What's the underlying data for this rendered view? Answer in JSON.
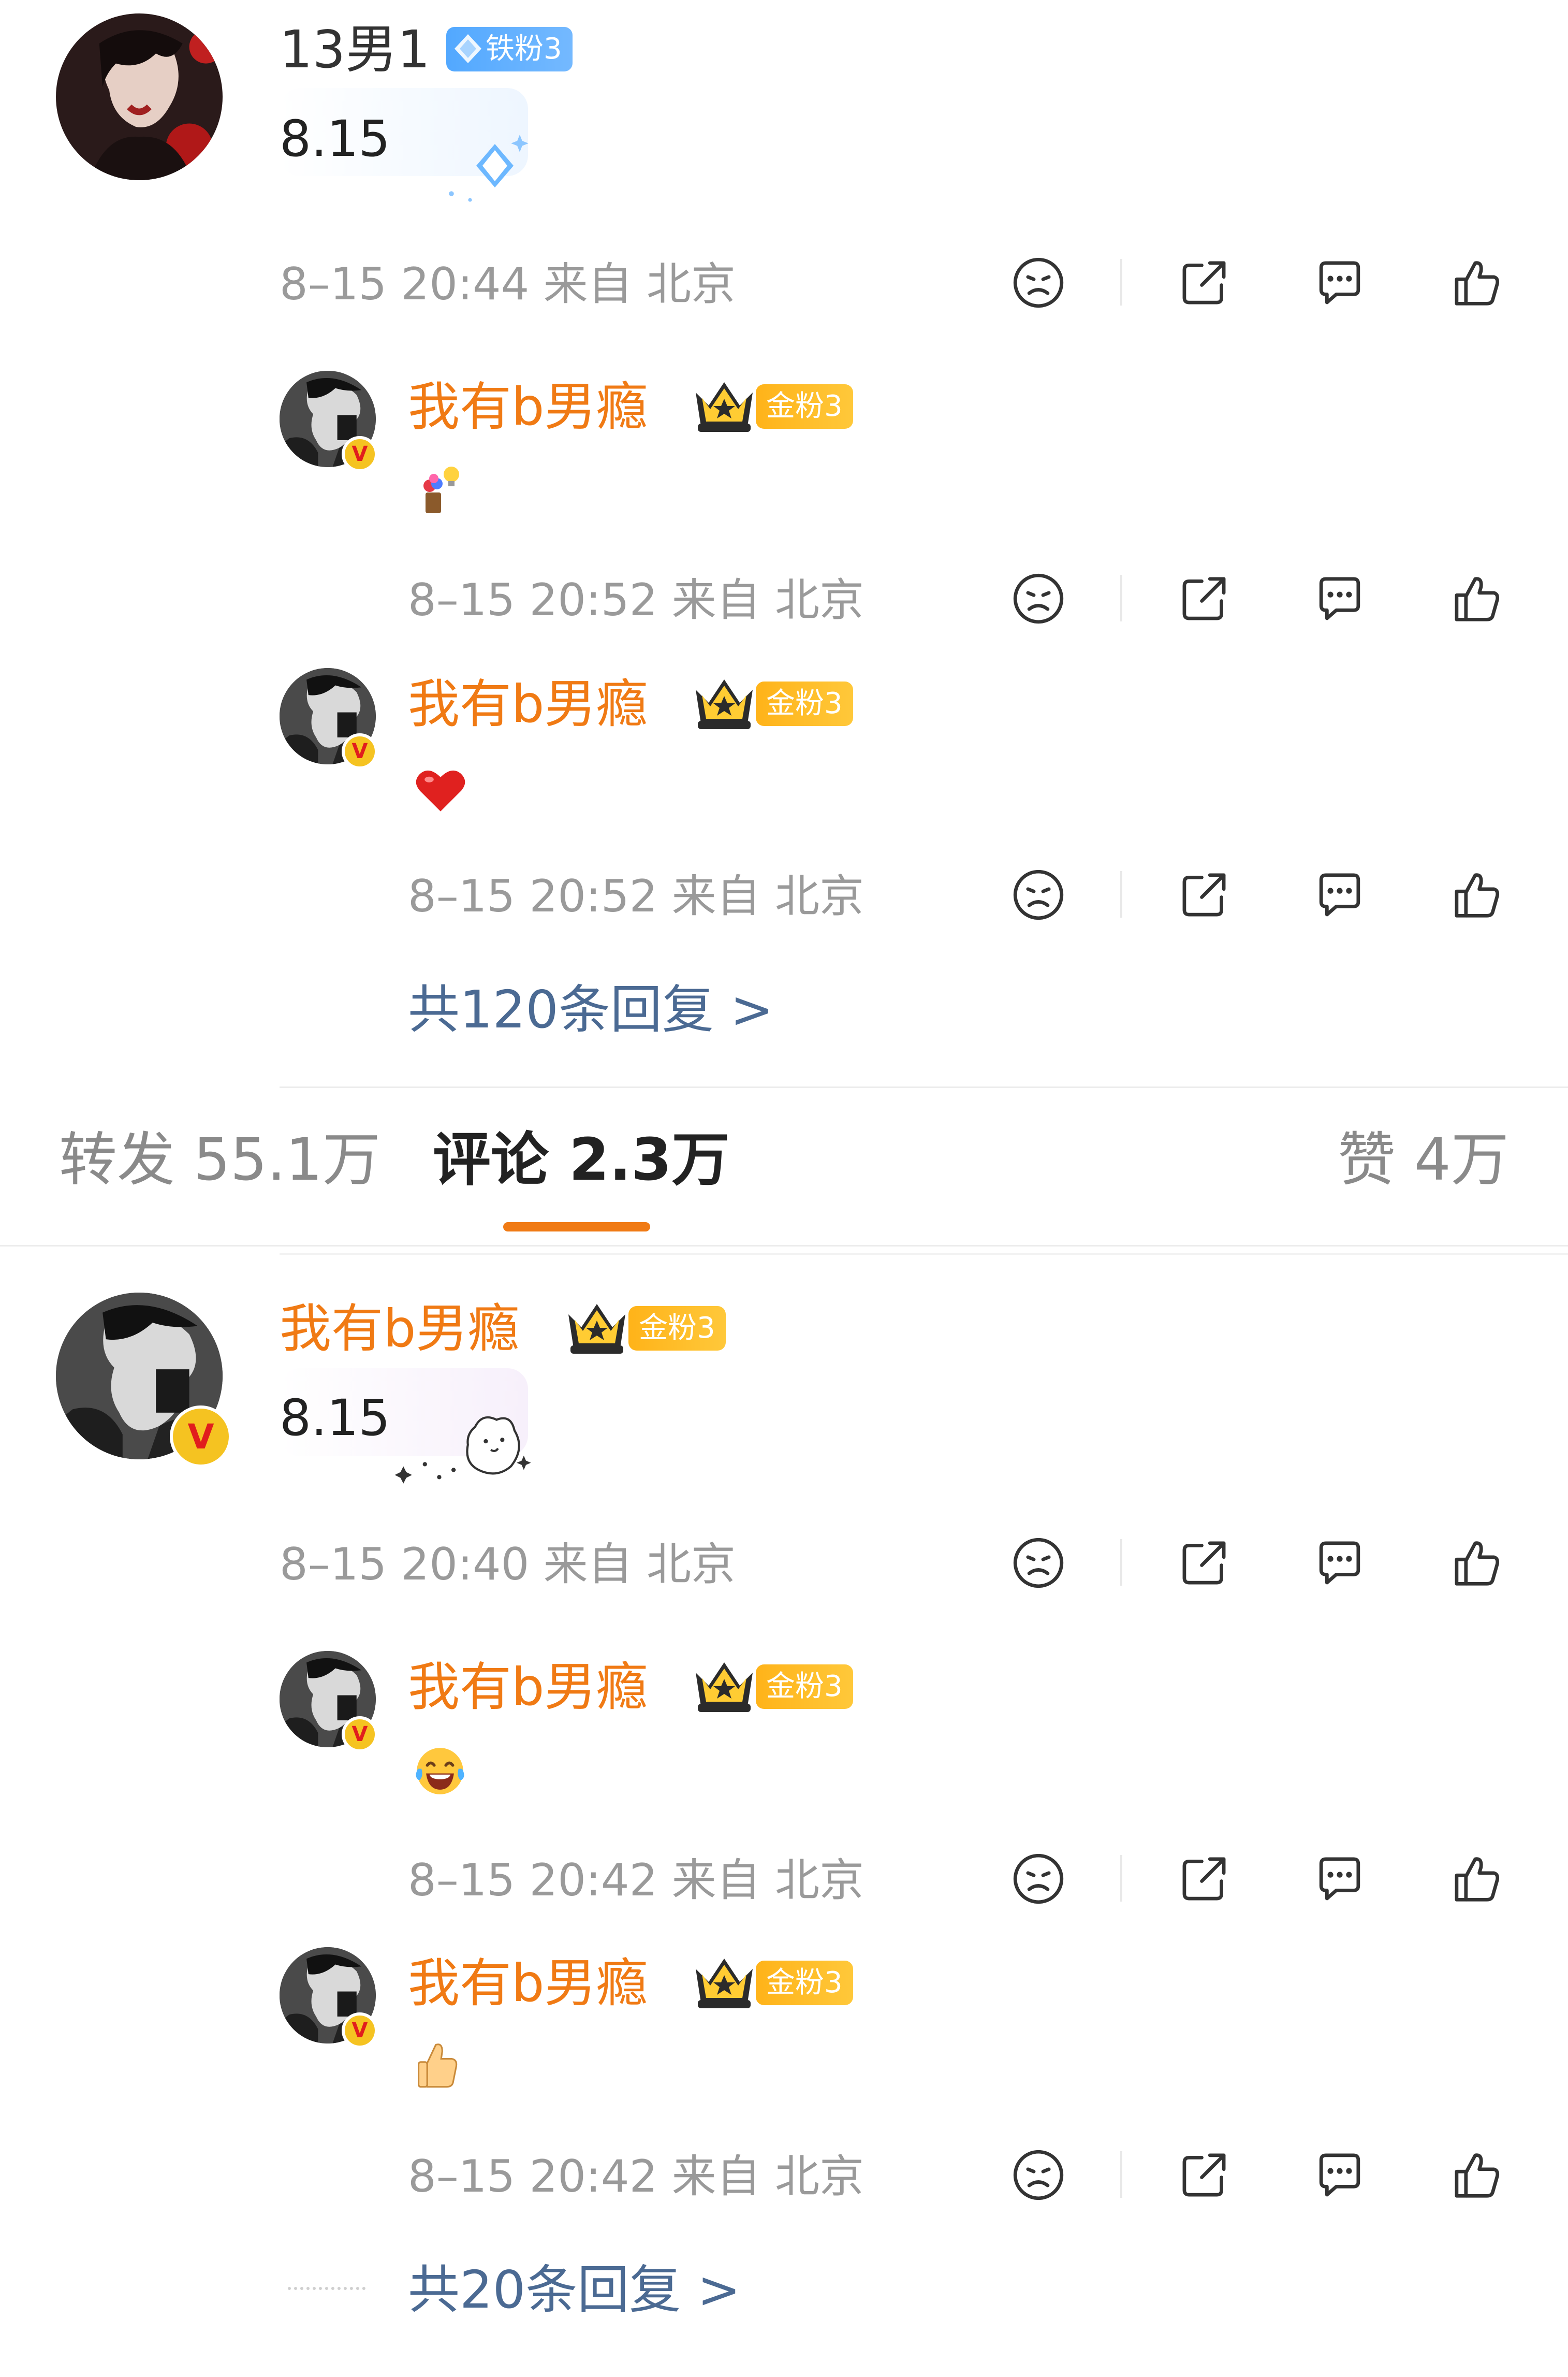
{
  "colors": {
    "accent": "#f07a14",
    "link": "#4b6a93",
    "meta": "#9a9a9a",
    "gold_badge": "#ffb319",
    "iron_badge": "#52a8ff"
  },
  "thread1": {
    "author": {
      "name": "13男1",
      "badge": "铁粉3",
      "badge_icon": "diamond-icon"
    },
    "text": "8.15",
    "meta": "8–15 20:44 来自 北京",
    "replies": [
      {
        "name": "我有b男瘾",
        "badge": "金粉3",
        "content_icon": "flower-bulb-emoji",
        "meta": "8–15 20:52 来自 北京"
      },
      {
        "name": "我有b男瘾",
        "badge": "金粉3",
        "content_icon": "red-heart-emoji",
        "meta": "8–15 20:52 来自 北京"
      }
    ],
    "more": "共120条回复 >"
  },
  "tabs": {
    "repost": "转发 55.1万",
    "comments": "评论 2.3万",
    "likes": "赞 4万",
    "active": "comments"
  },
  "thread2": {
    "author": {
      "name": "我有b男瘾",
      "badge": "金粉3"
    },
    "text": "8.15",
    "meta": "8–15 20:40 来自 北京",
    "replies": [
      {
        "name": "我有b男瘾",
        "badge": "金粉3",
        "content_icon": "laughing-tears-emoji",
        "meta": "8–15 20:42 来自 北京"
      },
      {
        "name": "我有b男瘾",
        "badge": "金粉3",
        "content_icon": "thumbs-up-emoji",
        "meta": "8–15 20:42 来自 北京"
      }
    ],
    "more": "共20条回复 >"
  },
  "actions": [
    "dislike-icon",
    "share-icon",
    "comment-icon",
    "like-icon"
  ]
}
